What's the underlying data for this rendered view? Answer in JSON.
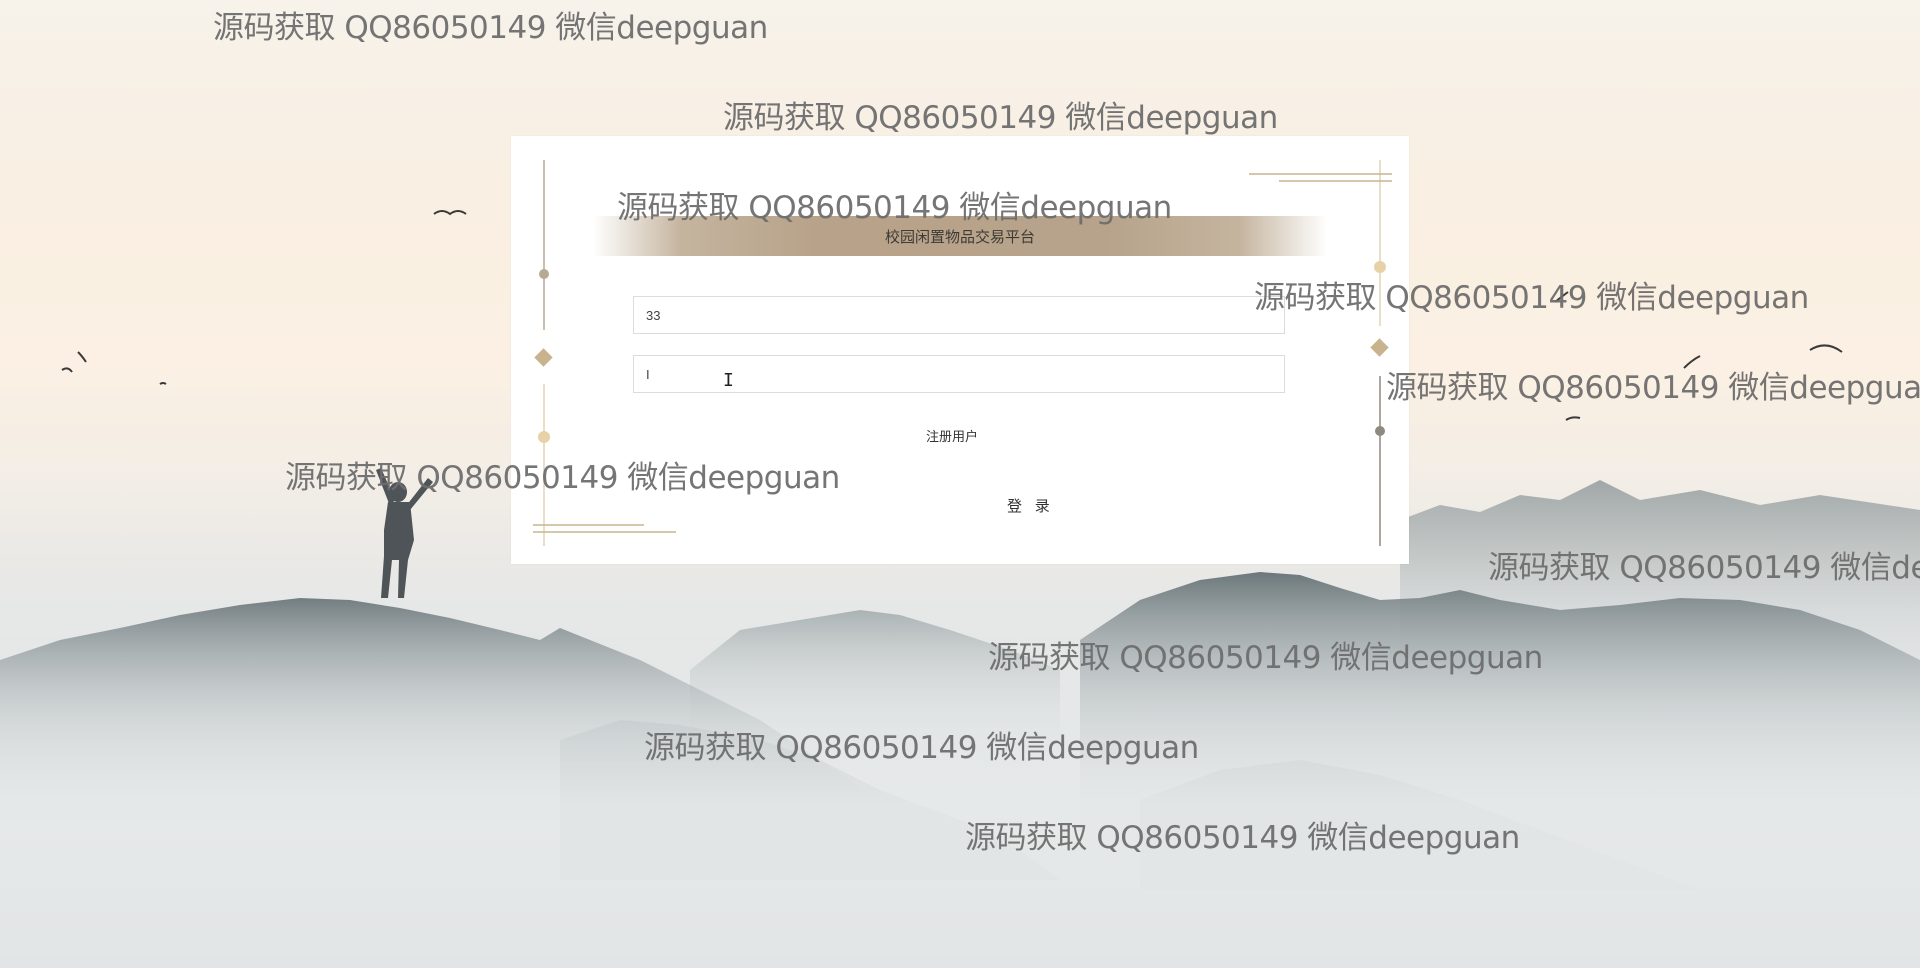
{
  "app": {
    "title": "校园闲置物品交易平台"
  },
  "login_form": {
    "username_value": "33",
    "password_value": "I",
    "register_label": "注册用户",
    "login_label": "登 录"
  },
  "watermark_text": "源码获取 QQ86050149 微信deepguan",
  "colors": {
    "accent_gold": "#c9b38f",
    "title_band": "#b7a38b",
    "card_background": "#ffffff"
  }
}
